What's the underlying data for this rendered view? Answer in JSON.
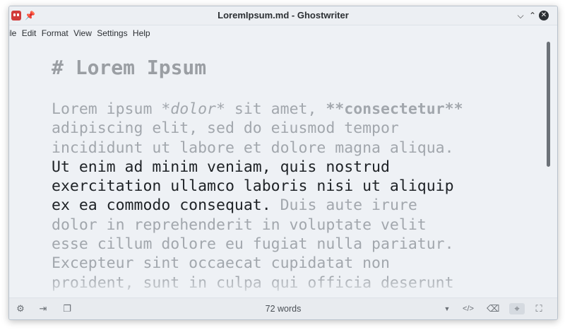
{
  "window": {
    "title": "LoremIpsum.md - Ghostwriter"
  },
  "menu": {
    "items": [
      "File",
      "Edit",
      "Format",
      "View",
      "Settings",
      "Help"
    ]
  },
  "editor": {
    "heading": "# Lorem Ipsum",
    "lines": [
      {
        "segments": [
          {
            "text": "Lorem ipsum *",
            "style": "normal"
          },
          {
            "text": "dolor",
            "style": "italic"
          },
          {
            "text": "* sit amet, ",
            "style": "normal"
          },
          {
            "text": "**consectetur**",
            "style": "bold"
          }
        ]
      },
      {
        "segments": [
          {
            "text": "adipiscing elit, sed do eiusmod tempor",
            "style": "normal"
          }
        ]
      },
      {
        "segments": [
          {
            "text": "incididunt ut labore et dolore magna aliqua.",
            "style": "normal"
          }
        ]
      },
      {
        "segments": [
          {
            "text": "Ut enim ad minim veniam, quis nostrud",
            "style": "active"
          }
        ]
      },
      {
        "segments": [
          {
            "text": "exercitation ullamco laboris nisi ut aliquip",
            "style": "active"
          }
        ]
      },
      {
        "segments": [
          {
            "text": "ex ea commodo consequat.",
            "style": "active"
          },
          {
            "text": " Duis aute irure",
            "style": "normal"
          }
        ]
      },
      {
        "segments": [
          {
            "text": "dolor in reprehenderit in voluptate velit",
            "style": "normal"
          }
        ]
      },
      {
        "segments": [
          {
            "text": "esse cillum dolore eu fugiat nulla pariatur.",
            "style": "normal"
          }
        ]
      },
      {
        "segments": [
          {
            "text": "Excepteur sint occaecat cupidatat non",
            "style": "normal"
          }
        ]
      },
      {
        "segments": [
          {
            "text": "proident, sunt in culpa qui officia deserunt",
            "style": "normal"
          }
        ]
      }
    ]
  },
  "scroll": {
    "visible_fraction": 0.49
  },
  "statusbar": {
    "word_count": "72 words"
  },
  "icons": {
    "left": [
      "gear-icon",
      "export-icon",
      "copy-icon"
    ],
    "right": [
      "chevron-down-icon",
      "code-icon",
      "backspace-icon",
      "target-icon",
      "fullscreen-icon"
    ]
  },
  "colors": {
    "window_bg": "#eef1f5",
    "dim_text": "#a2a7ad",
    "active_text": "#1e2226",
    "close_button": "#2b2f33",
    "app_icon": "#d13b3b"
  }
}
